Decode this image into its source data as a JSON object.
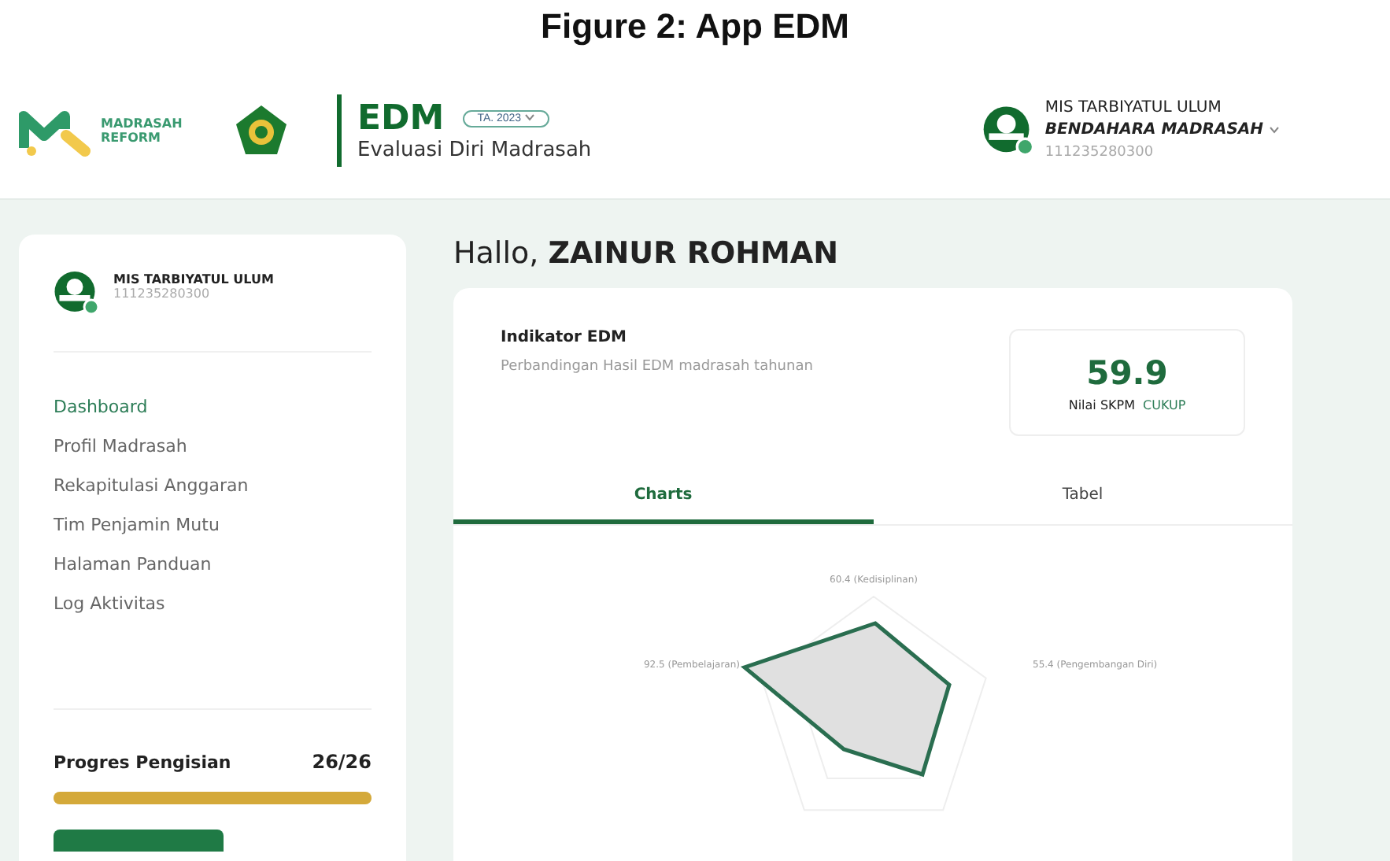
{
  "caption": "Figure 2: App EDM",
  "header": {
    "logo_words": [
      "MADRASAH",
      "REFORM"
    ],
    "app_name": "EDM",
    "year_select": "TA. 2023",
    "app_subtitle": "Evaluasi Diri Madrasah",
    "user": {
      "school": "MIS TARBIYATUL ULUM",
      "role": "BENDAHARA MADRASAH",
      "id": "111235280300"
    }
  },
  "sidebar": {
    "school": "MIS TARBIYATUL ULUM",
    "id": "111235280300",
    "items": [
      {
        "label": "Dashboard",
        "selected": true
      },
      {
        "label": "Profil Madrasah",
        "selected": false
      },
      {
        "label": "Rekapitulasi Anggaran",
        "selected": false
      },
      {
        "label": "Tim Penjamin Mutu",
        "selected": false
      },
      {
        "label": "Halaman Panduan",
        "selected": false
      },
      {
        "label": "Log Aktivitas",
        "selected": false
      }
    ],
    "progress": {
      "label": "Progres Pengisian",
      "count": "26/26",
      "level": 1
    }
  },
  "greeting": {
    "prefix": "Hallo, ",
    "name": "ZAINUR ROHMAN"
  },
  "card": {
    "title": "Indikator EDM",
    "subtitle": "Perbandingan Hasil EDM madrasah tahunan",
    "score": "59.9",
    "score_label": "Nilai SKPM",
    "score_grade": "CUKUP",
    "tabs": [
      {
        "label": "Charts",
        "selected": true
      },
      {
        "label": "Tabel",
        "selected": false
      }
    ],
    "radar_labels": [
      "60.4 (Kedisiplinan)",
      "92.5 (Pembelajaran)",
      "55.4 (Pengembangan Diri)"
    ]
  }
}
